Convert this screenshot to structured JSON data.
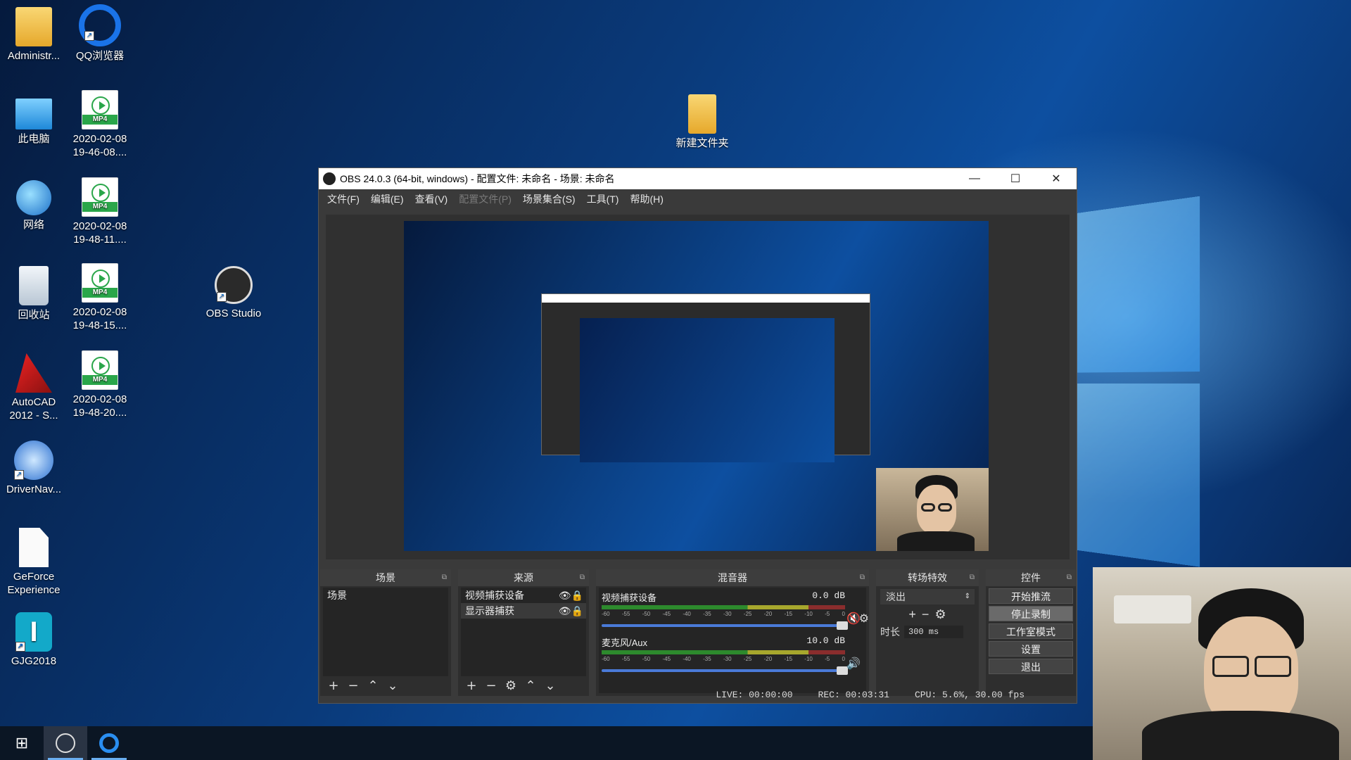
{
  "desktop": {
    "icons": [
      {
        "label": "Administr...",
        "icon": "user-folder-icon"
      },
      {
        "label": "QQ浏览器",
        "icon": "qq-browser-icon"
      },
      {
        "label": "此电脑",
        "icon": "computer-icon"
      },
      {
        "label": "2020-02-08 19-46-08....",
        "icon": "mp4-file-icon",
        "tag": "MP4"
      },
      {
        "label": "网络",
        "icon": "network-icon"
      },
      {
        "label": "2020-02-08 19-48-11....",
        "icon": "mp4-file-icon",
        "tag": "MP4"
      },
      {
        "label": "回收站",
        "icon": "recycle-bin-icon"
      },
      {
        "label": "2020-02-08 19-48-15....",
        "icon": "mp4-file-icon",
        "tag": "MP4"
      },
      {
        "label": "OBS Studio",
        "icon": "obs-icon"
      },
      {
        "label": "AutoCAD 2012 - S...",
        "icon": "autocad-icon"
      },
      {
        "label": "2020-02-08 19-48-20....",
        "icon": "mp4-file-icon",
        "tag": "MP4"
      },
      {
        "label": "DriverNav...",
        "icon": "drivernav-icon"
      },
      {
        "label": "GeForce Experience",
        "icon": "file-icon"
      },
      {
        "label": "GJG2018",
        "icon": "gjg-icon"
      },
      {
        "label": "新建文件夹",
        "icon": "folder-icon"
      }
    ]
  },
  "obs": {
    "title": "OBS 24.0.3 (64-bit, windows) - 配置文件: 未命名 - 场景: 未命名",
    "menu": [
      "文件(F)",
      "编辑(E)",
      "查看(V)",
      "配置文件(P)",
      "场景集合(S)",
      "工具(T)",
      "帮助(H)"
    ],
    "scenes": {
      "header": "场景",
      "items": [
        "场景"
      ]
    },
    "sources": {
      "header": "来源",
      "items": [
        "视频捕获设备",
        "显示器捕获"
      ]
    },
    "mixer": {
      "header": "混音器",
      "channels": [
        {
          "name": "视频捕获设备",
          "db": "0.0 dB",
          "muted": true,
          "level": 0.0
        },
        {
          "name": "麦克风/Aux",
          "db": "10.0 dB",
          "muted": false,
          "level": 0.45
        }
      ],
      "scale": [
        "-60",
        "-55",
        "-50",
        "-45",
        "-40",
        "-35",
        "-30",
        "-25",
        "-20",
        "-15",
        "-10",
        "-5",
        "0"
      ]
    },
    "transitions": {
      "header": "转场特效",
      "selected": "淡出",
      "duration_label": "时长",
      "duration_value": "300 ms"
    },
    "controls": {
      "header": "控件",
      "buttons": [
        "开始推流",
        "停止录制",
        "工作室模式",
        "设置",
        "退出"
      ]
    },
    "status": {
      "live": "LIVE: 00:00:00",
      "rec": "REC: 00:03:31",
      "cpu": "CPU: 5.6%, 30.00 fps"
    }
  },
  "colors": {
    "accent": "#4a7ad8",
    "meter_green": "#2d8a2d",
    "meter_yellow": "#a7a72d",
    "mute_red": "#d03030"
  }
}
